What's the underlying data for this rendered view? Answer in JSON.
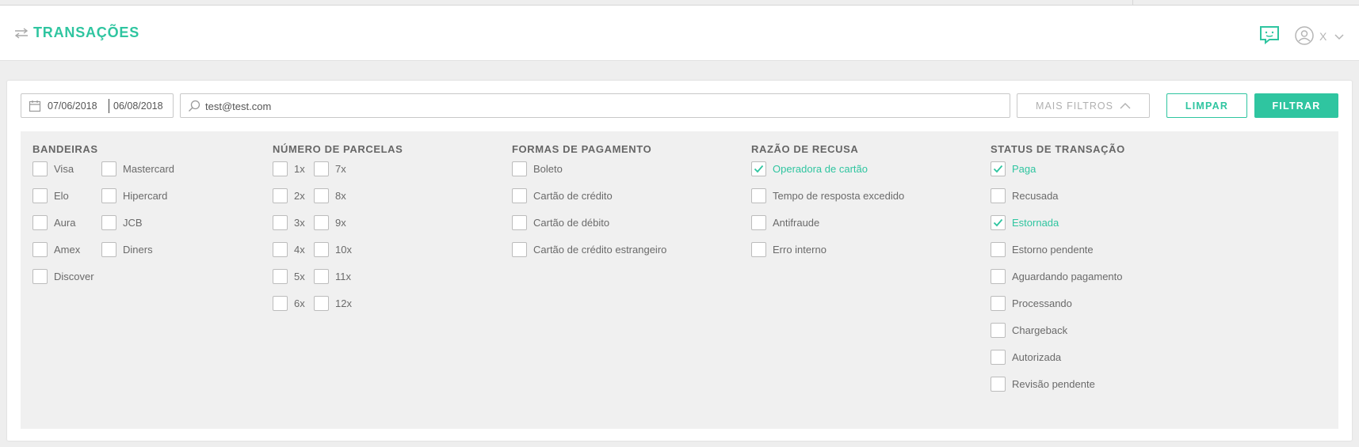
{
  "app": {
    "title": "TRANSAÇÕES",
    "user_name": "X",
    "accent": "#2fc5a0"
  },
  "filters_bar": {
    "date_from": "07/06/2018",
    "date_to": "06/08/2018",
    "search_value": "test@test.com",
    "more_filters_label": "MAIS FILTROS",
    "clear_label": "LIMPAR",
    "filter_label": "FILTRAR"
  },
  "groups": {
    "bandeiras": {
      "title": "BANDEIRAS",
      "col1": [
        {
          "label": "Visa",
          "checked": false
        },
        {
          "label": "Elo",
          "checked": false
        },
        {
          "label": "Aura",
          "checked": false
        },
        {
          "label": "Amex",
          "checked": false
        },
        {
          "label": "Discover",
          "checked": false
        }
      ],
      "col2": [
        {
          "label": "Mastercard",
          "checked": false
        },
        {
          "label": "Hipercard",
          "checked": false
        },
        {
          "label": "JCB",
          "checked": false
        },
        {
          "label": "Diners",
          "checked": false
        }
      ]
    },
    "parcelas": {
      "title": "NÚMERO DE PARCELAS",
      "col1": [
        {
          "label": "1x",
          "checked": false
        },
        {
          "label": "2x",
          "checked": false
        },
        {
          "label": "3x",
          "checked": false
        },
        {
          "label": "4x",
          "checked": false
        },
        {
          "label": "5x",
          "checked": false
        },
        {
          "label": "6x",
          "checked": false
        }
      ],
      "col2": [
        {
          "label": "7x",
          "checked": false
        },
        {
          "label": "8x",
          "checked": false
        },
        {
          "label": "9x",
          "checked": false
        },
        {
          "label": "10x",
          "checked": false
        },
        {
          "label": "11x",
          "checked": false
        },
        {
          "label": "12x",
          "checked": false
        }
      ]
    },
    "pagamento": {
      "title": "FORMAS DE PAGAMENTO",
      "col1": [
        {
          "label": "Boleto",
          "checked": false
        },
        {
          "label": "Cartão de crédito",
          "checked": false
        },
        {
          "label": "Cartão de débito",
          "checked": false
        },
        {
          "label": "Cartão de crédito estrangeiro",
          "checked": false
        }
      ]
    },
    "recusa": {
      "title": "RAZÃO DE RECUSA",
      "col1": [
        {
          "label": "Operadora de cartão",
          "checked": true
        },
        {
          "label": "Tempo de resposta excedido",
          "checked": false
        },
        {
          "label": "Antifraude",
          "checked": false
        },
        {
          "label": "Erro interno",
          "checked": false
        }
      ]
    },
    "status": {
      "title": "STATUS DE TRANSAÇÃO",
      "col1": [
        {
          "label": "Paga",
          "checked": true
        },
        {
          "label": "Recusada",
          "checked": false
        },
        {
          "label": "Estornada",
          "checked": true
        },
        {
          "label": "Estorno pendente",
          "checked": false
        },
        {
          "label": "Aguardando pagamento",
          "checked": false
        },
        {
          "label": "Processando",
          "checked": false
        },
        {
          "label": "Chargeback",
          "checked": false
        },
        {
          "label": "Autorizada",
          "checked": false
        },
        {
          "label": "Revisão pendente",
          "checked": false
        }
      ]
    }
  }
}
